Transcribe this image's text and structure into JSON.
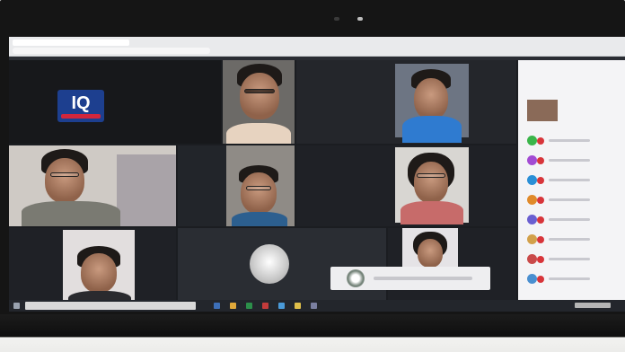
{
  "browser": {
    "tab_title": "",
    "url": ""
  },
  "meeting": {
    "tiles": [
      {
        "name": ""
      },
      {
        "name": ""
      },
      {
        "name": ""
      },
      {
        "name": ""
      },
      {
        "name": ""
      },
      {
        "name": ""
      },
      {
        "name": ""
      },
      {
        "name": ""
      },
      {
        "name": ""
      }
    ],
    "logo_text": "IQ"
  },
  "participants_panel": {
    "title": "",
    "accent_colors": [
      "#3ab54a",
      "#d8353a",
      "#a24bd3",
      "#2a8fd6",
      "#e08a2a"
    ]
  },
  "taskbar": {
    "search_placeholder": ""
  }
}
